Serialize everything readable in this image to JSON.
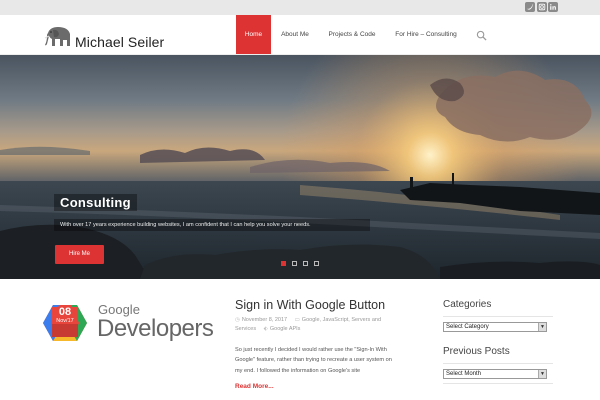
{
  "topbar": {
    "social": [
      {
        "icon": "twitter-icon"
      },
      {
        "icon": "instagram-icon"
      },
      {
        "icon": "linkedin-icon"
      }
    ]
  },
  "header": {
    "site_title": "Michael Seiler",
    "logo_icon": "elephant-logo"
  },
  "nav": {
    "items": [
      {
        "label": "Home",
        "active": true
      },
      {
        "label": "About Me",
        "active": false
      },
      {
        "label": "Projects & Code",
        "active": false
      },
      {
        "label": "For Hire – Consulting",
        "active": false
      }
    ],
    "search_icon": "search-icon"
  },
  "slider": {
    "title": "Consulting",
    "text": "With over 17 years experience building websites, I am confident that I can help you solve your needs.",
    "button": "Hire Me",
    "active_slide": 1,
    "slide_count": 4
  },
  "post": {
    "thumb": {
      "day": "08",
      "month_year": "Nov/17",
      "brand_top": "Google",
      "brand_bottom": "Developers"
    },
    "title": "Sign in With Google Button",
    "date": "November 8, 2017",
    "categories_line1": [
      "Google",
      "JavaScript",
      "Servers and"
    ],
    "categories_line2": "Services",
    "tag": "Google APIs",
    "excerpt_lines": [
      "So just recently I decided I would rather use the \"Sign-In With",
      "Google\" feature, rather than trying to recreate a user system on",
      "my end. I followed the information on Google's site"
    ],
    "read_more": "Read More..."
  },
  "sidebar": {
    "categories_title": "Categories",
    "categories_select": "Select Category",
    "previous_title": "Previous Posts",
    "previous_select": "Select Month"
  },
  "colors": {
    "accent": "#dd3333",
    "topbar": "#e8e8e8"
  }
}
